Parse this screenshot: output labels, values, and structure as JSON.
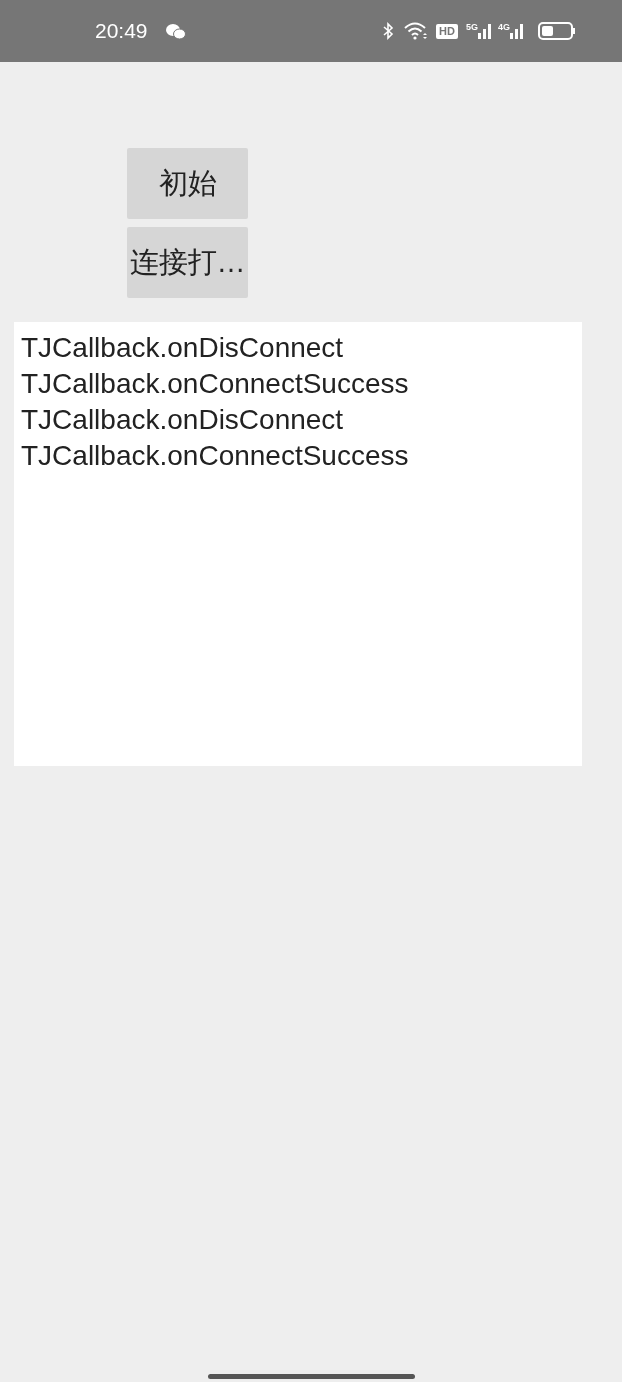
{
  "status_bar": {
    "time": "20:49",
    "hd_label": "HD",
    "networks": [
      "5G",
      "4G"
    ]
  },
  "buttons": [
    "初始",
    "连接打…"
  ],
  "log": {
    "lines": [
      "TJCallback.onDisConnect",
      "TJCallback.onConnectSuccess",
      "TJCallback.onDisConnect",
      "TJCallback.onConnectSuccess"
    ]
  }
}
